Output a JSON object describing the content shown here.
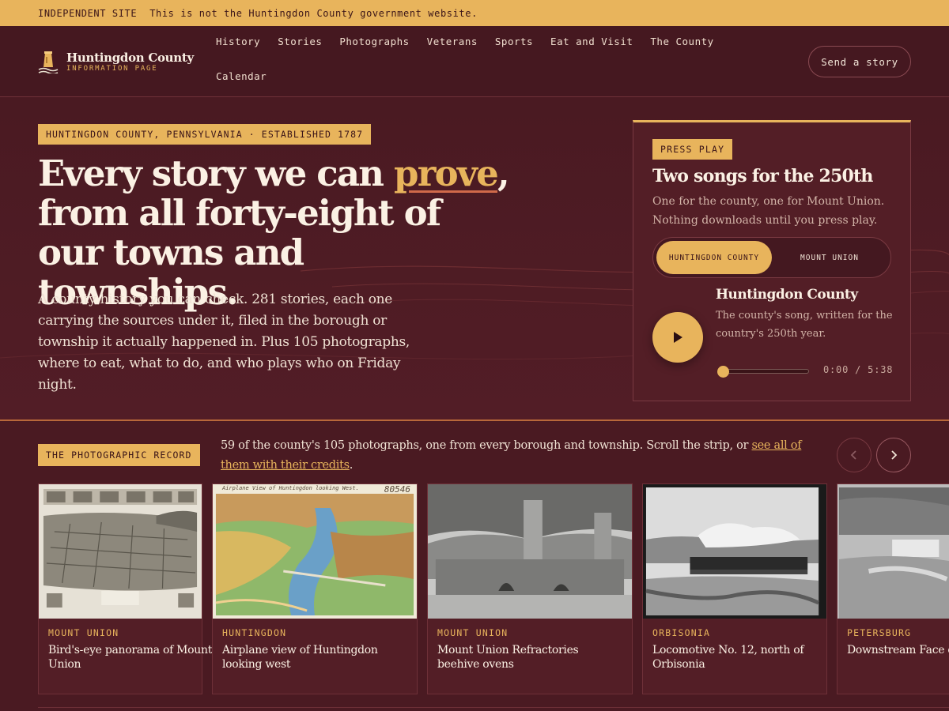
{
  "notice": {
    "tag": "INDEPENDENT SITE",
    "text": "This is not the Huntingdon County government website."
  },
  "brand": {
    "name": "Huntingdon County",
    "subtitle": "INFORMATION PAGE"
  },
  "nav": {
    "items": [
      "History",
      "Stories",
      "Photographs",
      "Veterans",
      "Sports",
      "Eat and Visit",
      "The County",
      "Calendar"
    ],
    "cta": "Send a story"
  },
  "hero": {
    "eyebrow": "HUNTINGDON COUNTY, PENNSYLVANIA · ESTABLISHED 1787",
    "headline_before": "Every story we can ",
    "headline_highlight": "prove",
    "headline_after": ", from all forty-eight of our towns and townships.",
    "lede": "A county history you can check. 281 stories, each one carrying the sources under it, filed in the borough or township it actually happened in. Plus 105 photographs, where to eat, what to do, and who plays who on Friday night."
  },
  "player": {
    "tag": "PRESS PLAY",
    "title": "Two songs for the 250th",
    "subtitle": "One for the county, one for Mount Union. Nothing downloads until you press play.",
    "options": [
      "HUNTINGDON COUNTY",
      "MOUNT UNION"
    ],
    "selected": "HUNTINGDON COUNTY",
    "track_title": "Huntingdon County",
    "track_desc": "The county's song, written for the country's 250th year.",
    "time": "0:00 / 5:38",
    "progress": 0
  },
  "photos": {
    "tag": "THE PHOTOGRAPHIC RECORD",
    "desc_before": "59 of the county's 105 photographs, one from every borough and township. Scroll the strip, or ",
    "desc_link": "see all of them with their credits",
    "desc_after": ".",
    "cards": [
      {
        "place": "MOUNT UNION",
        "title": "Bird's-eye panorama of Mount Union"
      },
      {
        "place": "HUNTINGDON",
        "title": "Airplane view of Huntingdon looking west"
      },
      {
        "place": "MOUNT UNION",
        "title": "Mount Union Refractories beehive ovens"
      },
      {
        "place": "ORBISONIA",
        "title": "Locomotive No. 12, north of Orbisonia"
      },
      {
        "place": "PETERSBURG",
        "title": "Downstream Face of Tailrace"
      }
    ],
    "postcard_caption": "Airplane View of Huntingdon looking West.",
    "postcard_number": "80546"
  },
  "icons": {
    "prev": "chevron-left-icon",
    "next": "chevron-right-icon",
    "play": "play-icon",
    "brand": "lighthouse-icon"
  },
  "colors": {
    "background": "#4a1a22",
    "accent": "#e8b45c",
    "highlight_underline": "#d06a4a"
  }
}
